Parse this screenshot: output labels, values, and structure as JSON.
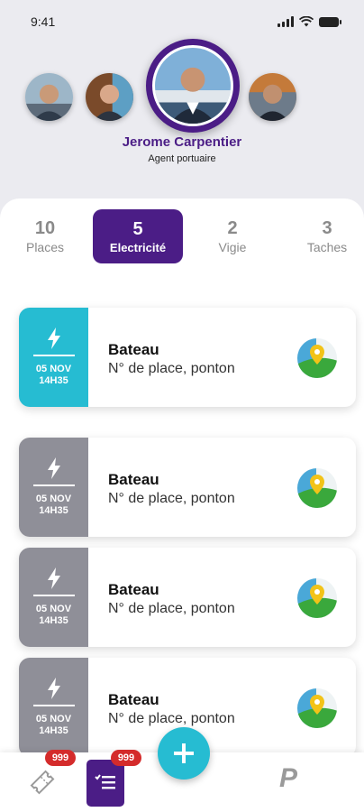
{
  "status": {
    "time": "9:41"
  },
  "profile": {
    "name": "Jerome Carpentier",
    "role": "Agent portuaire"
  },
  "tabs": [
    {
      "count": "10",
      "label": "Places"
    },
    {
      "count": "5",
      "label": "Electricité"
    },
    {
      "count": "2",
      "label": "Vigie"
    },
    {
      "count": "3",
      "label": "Taches"
    }
  ],
  "list": [
    {
      "date_line1": "05 NOV",
      "date_line2": "14H35",
      "title": "Bateau",
      "subtitle": "N° de place, ponton",
      "status_color": "#26bcd2"
    },
    {
      "date_line1": "05 NOV",
      "date_line2": "14H35",
      "title": "Bateau",
      "subtitle": "N° de place, ponton",
      "status_color": "#8f8f98"
    },
    {
      "date_line1": "05 NOV",
      "date_line2": "14H35",
      "title": "Bateau",
      "subtitle": "N° de place, ponton",
      "status_color": "#8f8f98"
    },
    {
      "date_line1": "05 NOV",
      "date_line2": "14H35",
      "title": "Bateau",
      "subtitle": "N° de place, ponton",
      "status_color": "#8f8f98"
    }
  ],
  "nav": {
    "ticket_badge": "999",
    "list_badge": "999",
    "parking_label": "P"
  },
  "colors": {
    "accent": "#4b1d86",
    "highlight": "#26bcd2",
    "inactive": "#8f8f98",
    "badge": "#d42b2b"
  },
  "icons": [
    "lightning-icon",
    "map-pin-icon",
    "ticket-icon",
    "checklist-icon",
    "plus-icon",
    "signal-icon",
    "wifi-icon",
    "battery-icon"
  ]
}
